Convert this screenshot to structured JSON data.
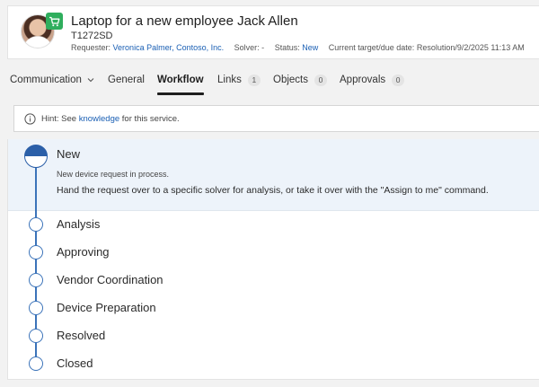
{
  "header": {
    "title": "Laptop for a new employee Jack Allen",
    "ticket_id": "T1272SD",
    "requester_label": "Requester:",
    "requester_value": "Veronica Palmer, Contoso, Inc.",
    "solver_label": "Solver:",
    "solver_value": "-",
    "status_label": "Status:",
    "status_value": "New",
    "target_label": "Current target/due date:",
    "target_value": "Resolution/9/2/2025 11:13 AM"
  },
  "tabs": [
    {
      "label": "Communication",
      "count": null
    },
    {
      "label": "General",
      "count": null
    },
    {
      "label": "Workflow",
      "count": null
    },
    {
      "label": "Links",
      "count": "1"
    },
    {
      "label": "Objects",
      "count": "0"
    },
    {
      "label": "Approvals",
      "count": "0"
    }
  ],
  "hint": {
    "prefix": "Hint: See",
    "link": "knowledge",
    "suffix": "for this service."
  },
  "workflow": {
    "current": {
      "label": "New",
      "description": "New device request in process.",
      "instruction": "Hand the request over to a specific solver for analysis, or take it over with the \"Assign to me\" command."
    },
    "steps": [
      "Analysis",
      "Approving",
      "Vendor Coordination",
      "Device Preparation",
      "Resolved",
      "Closed"
    ]
  },
  "colors": {
    "accent": "#2b5fa8",
    "link": "#1a5fb4",
    "active_bg": "#edf3fa",
    "cart_badge": "#2fae5d"
  }
}
